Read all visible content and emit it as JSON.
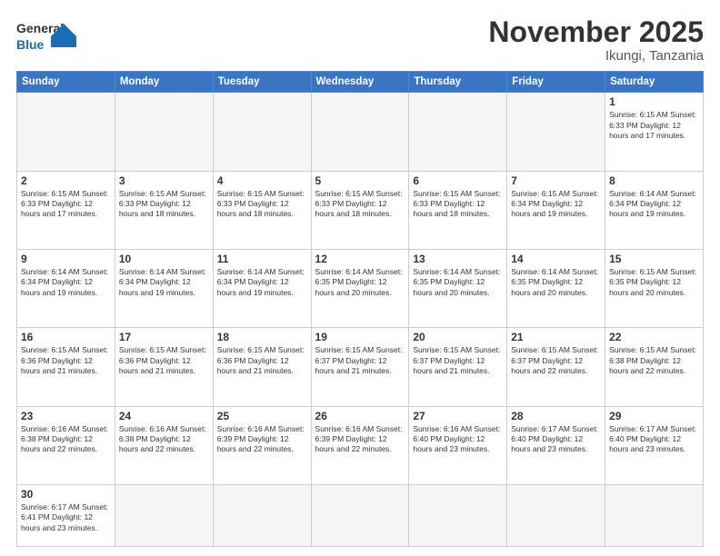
{
  "logo": {
    "text_general": "General",
    "text_blue": "Blue"
  },
  "header": {
    "month": "November 2025",
    "location": "Ikungi, Tanzania"
  },
  "weekdays": [
    "Sunday",
    "Monday",
    "Tuesday",
    "Wednesday",
    "Thursday",
    "Friday",
    "Saturday"
  ],
  "weeks": [
    [
      {
        "day": "",
        "info": "",
        "empty": true
      },
      {
        "day": "",
        "info": "",
        "empty": true
      },
      {
        "day": "",
        "info": "",
        "empty": true
      },
      {
        "day": "",
        "info": "",
        "empty": true
      },
      {
        "day": "",
        "info": "",
        "empty": true
      },
      {
        "day": "",
        "info": "",
        "empty": true
      },
      {
        "day": "1",
        "info": "Sunrise: 6:15 AM\nSunset: 6:33 PM\nDaylight: 12 hours\nand 17 minutes."
      }
    ],
    [
      {
        "day": "2",
        "info": "Sunrise: 6:15 AM\nSunset: 6:33 PM\nDaylight: 12 hours\nand 17 minutes."
      },
      {
        "day": "3",
        "info": "Sunrise: 6:15 AM\nSunset: 6:33 PM\nDaylight: 12 hours\nand 18 minutes."
      },
      {
        "day": "4",
        "info": "Sunrise: 6:15 AM\nSunset: 6:33 PM\nDaylight: 12 hours\nand 18 minutes."
      },
      {
        "day": "5",
        "info": "Sunrise: 6:15 AM\nSunset: 6:33 PM\nDaylight: 12 hours\nand 18 minutes."
      },
      {
        "day": "6",
        "info": "Sunrise: 6:15 AM\nSunset: 6:33 PM\nDaylight: 12 hours\nand 18 minutes."
      },
      {
        "day": "7",
        "info": "Sunrise: 6:15 AM\nSunset: 6:34 PM\nDaylight: 12 hours\nand 19 minutes."
      },
      {
        "day": "8",
        "info": "Sunrise: 6:14 AM\nSunset: 6:34 PM\nDaylight: 12 hours\nand 19 minutes."
      }
    ],
    [
      {
        "day": "9",
        "info": "Sunrise: 6:14 AM\nSunset: 6:34 PM\nDaylight: 12 hours\nand 19 minutes."
      },
      {
        "day": "10",
        "info": "Sunrise: 6:14 AM\nSunset: 6:34 PM\nDaylight: 12 hours\nand 19 minutes."
      },
      {
        "day": "11",
        "info": "Sunrise: 6:14 AM\nSunset: 6:34 PM\nDaylight: 12 hours\nand 19 minutes."
      },
      {
        "day": "12",
        "info": "Sunrise: 6:14 AM\nSunset: 6:35 PM\nDaylight: 12 hours\nand 20 minutes."
      },
      {
        "day": "13",
        "info": "Sunrise: 6:14 AM\nSunset: 6:35 PM\nDaylight: 12 hours\nand 20 minutes."
      },
      {
        "day": "14",
        "info": "Sunrise: 6:14 AM\nSunset: 6:35 PM\nDaylight: 12 hours\nand 20 minutes."
      },
      {
        "day": "15",
        "info": "Sunrise: 6:15 AM\nSunset: 6:35 PM\nDaylight: 12 hours\nand 20 minutes."
      }
    ],
    [
      {
        "day": "16",
        "info": "Sunrise: 6:15 AM\nSunset: 6:36 PM\nDaylight: 12 hours\nand 21 minutes."
      },
      {
        "day": "17",
        "info": "Sunrise: 6:15 AM\nSunset: 6:36 PM\nDaylight: 12 hours\nand 21 minutes."
      },
      {
        "day": "18",
        "info": "Sunrise: 6:15 AM\nSunset: 6:36 PM\nDaylight: 12 hours\nand 21 minutes."
      },
      {
        "day": "19",
        "info": "Sunrise: 6:15 AM\nSunset: 6:37 PM\nDaylight: 12 hours\nand 21 minutes."
      },
      {
        "day": "20",
        "info": "Sunrise: 6:15 AM\nSunset: 6:37 PM\nDaylight: 12 hours\nand 21 minutes."
      },
      {
        "day": "21",
        "info": "Sunrise: 6:15 AM\nSunset: 6:37 PM\nDaylight: 12 hours\nand 22 minutes."
      },
      {
        "day": "22",
        "info": "Sunrise: 6:15 AM\nSunset: 6:38 PM\nDaylight: 12 hours\nand 22 minutes."
      }
    ],
    [
      {
        "day": "23",
        "info": "Sunrise: 6:16 AM\nSunset: 6:38 PM\nDaylight: 12 hours\nand 22 minutes."
      },
      {
        "day": "24",
        "info": "Sunrise: 6:16 AM\nSunset: 6:38 PM\nDaylight: 12 hours\nand 22 minutes."
      },
      {
        "day": "25",
        "info": "Sunrise: 6:16 AM\nSunset: 6:39 PM\nDaylight: 12 hours\nand 22 minutes."
      },
      {
        "day": "26",
        "info": "Sunrise: 6:16 AM\nSunset: 6:39 PM\nDaylight: 12 hours\nand 22 minutes."
      },
      {
        "day": "27",
        "info": "Sunrise: 6:16 AM\nSunset: 6:40 PM\nDaylight: 12 hours\nand 23 minutes."
      },
      {
        "day": "28",
        "info": "Sunrise: 6:17 AM\nSunset: 6:40 PM\nDaylight: 12 hours\nand 23 minutes."
      },
      {
        "day": "29",
        "info": "Sunrise: 6:17 AM\nSunset: 6:40 PM\nDaylight: 12 hours\nand 23 minutes."
      }
    ],
    [
      {
        "day": "30",
        "info": "Sunrise: 6:17 AM\nSunset: 6:41 PM\nDaylight: 12 hours\nand 23 minutes.",
        "last": true
      },
      {
        "day": "",
        "info": "",
        "empty": true,
        "last": true
      },
      {
        "day": "",
        "info": "",
        "empty": true,
        "last": true
      },
      {
        "day": "",
        "info": "",
        "empty": true,
        "last": true
      },
      {
        "day": "",
        "info": "",
        "empty": true,
        "last": true
      },
      {
        "day": "",
        "info": "",
        "empty": true,
        "last": true
      },
      {
        "day": "",
        "info": "",
        "empty": true,
        "last": true
      }
    ]
  ]
}
